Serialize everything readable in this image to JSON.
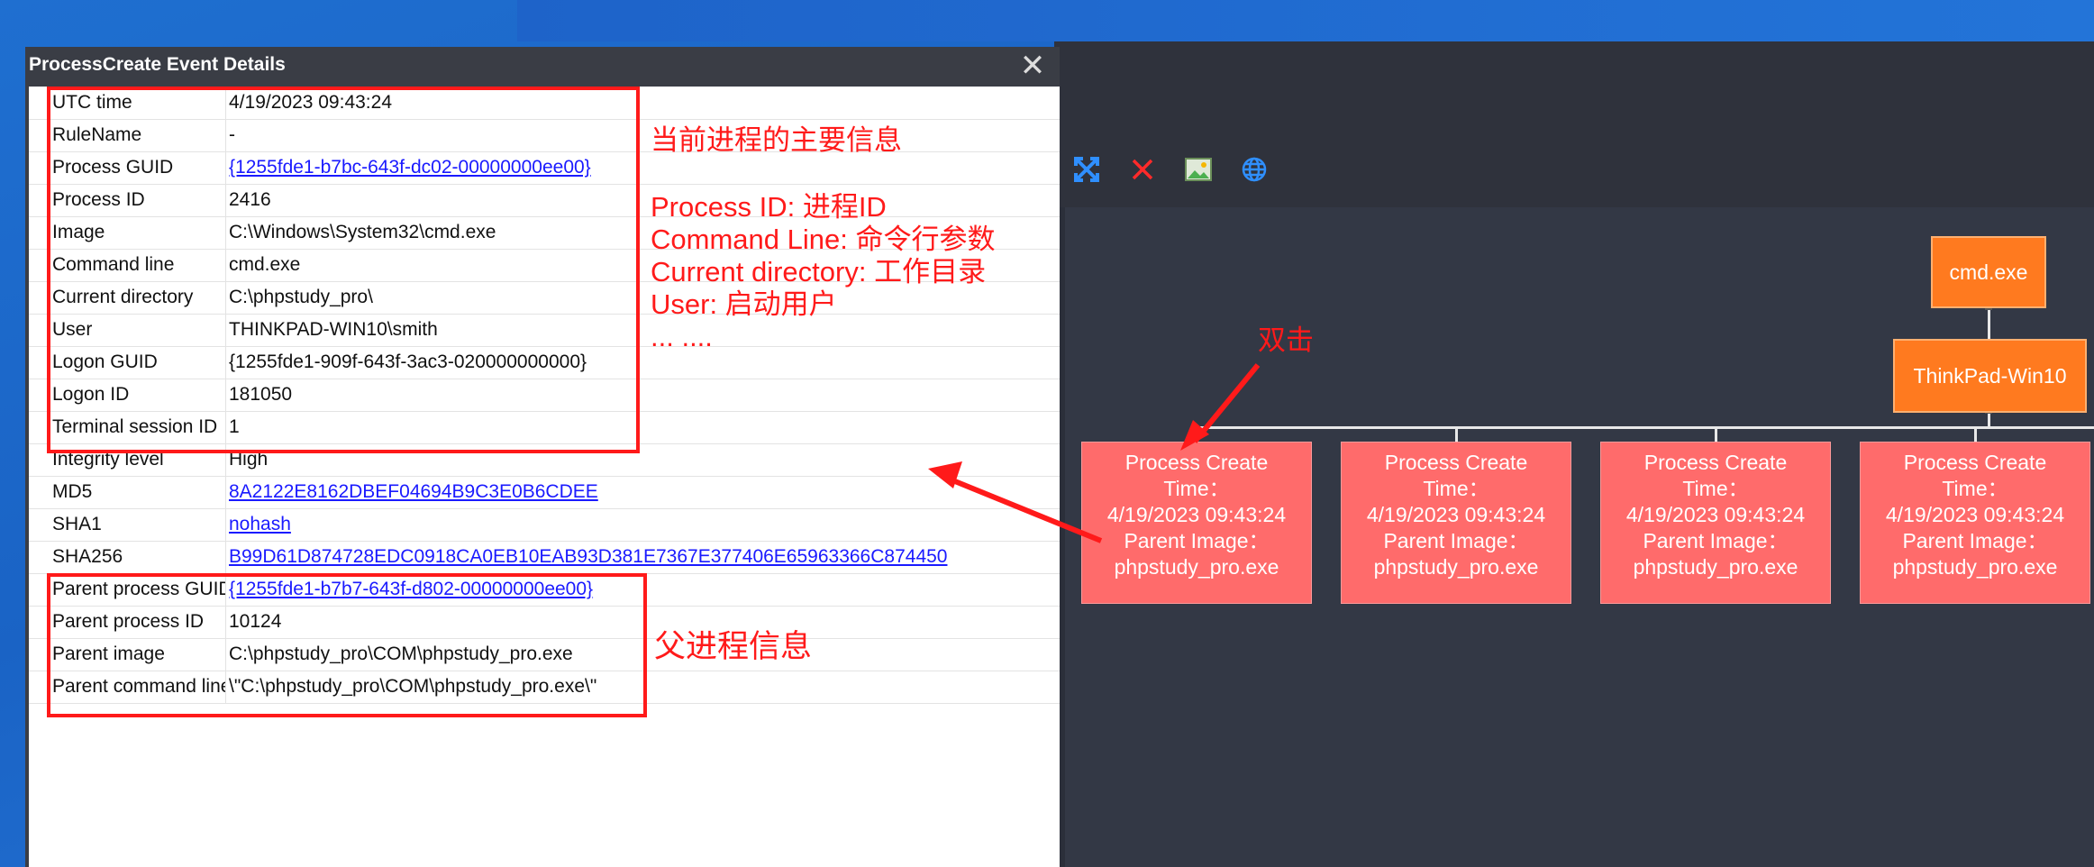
{
  "dialog": {
    "title": "ProcessCreate Event Details",
    "close_label": "✕",
    "rows": [
      {
        "key": "UTC time",
        "value": "4/19/2023 09:43:24",
        "link": false
      },
      {
        "key": "RuleName",
        "value": "-",
        "link": false
      },
      {
        "key": "Process GUID",
        "value": "{1255fde1-b7bc-643f-dc02-00000000ee00}",
        "link": true
      },
      {
        "key": "Process ID",
        "value": "2416",
        "link": false
      },
      {
        "key": "Image",
        "value": "C:\\Windows\\System32\\cmd.exe",
        "link": false
      },
      {
        "key": "Command line",
        "value": "cmd.exe",
        "link": false
      },
      {
        "key": "Current directory",
        "value": "C:\\phpstudy_pro\\",
        "link": false
      },
      {
        "key": "User",
        "value": "THINKPAD-WIN10\\smith",
        "link": false
      },
      {
        "key": "Logon GUID",
        "value": "{1255fde1-909f-643f-3ac3-020000000000}",
        "link": false
      },
      {
        "key": "Logon ID",
        "value": "181050",
        "link": false
      },
      {
        "key": "Terminal session ID",
        "value": "1",
        "link": false
      },
      {
        "key": "Integrity level",
        "value": "High",
        "link": false
      },
      {
        "key": "MD5",
        "value": "8A2122E8162DBEF04694B9C3E0B6CDEE",
        "link": true
      },
      {
        "key": "SHA1",
        "value": "nohash",
        "link": true
      },
      {
        "key": "SHA256",
        "value": "B99D61D874728EDC0918CA0EB10EAB93D381E7367E377406E65963366C874450",
        "link": true
      },
      {
        "key": "Parent process GUID",
        "value": "{1255fde1-b7b7-643f-d802-00000000ee00}",
        "link": true
      },
      {
        "key": "Parent process ID",
        "value": "10124",
        "link": false
      },
      {
        "key": "Parent image",
        "value": "C:\\phpstudy_pro\\COM\\phpstudy_pro.exe",
        "link": false
      },
      {
        "key": "Parent command line",
        "value": "\\\"C:\\phpstudy_pro\\COM\\phpstudy_pro.exe\\\"",
        "link": false
      }
    ]
  },
  "annotations": {
    "main_info": "当前进程的主要信息",
    "lines": [
      "Process ID: 进程ID",
      "Command Line: 命令行参数",
      "Current directory: 工作目录",
      "User: 启动用户",
      "... ...."
    ],
    "parent_info": "父进程信息",
    "double_click": "双击"
  },
  "toolbar": {
    "icons": [
      "fullscreen-icon",
      "delete-icon",
      "image-icon",
      "globe-icon"
    ]
  },
  "graph": {
    "root": "cmd.exe",
    "host": "ThinkPad-Win10",
    "nodes": [
      {
        "l1": "Process Create",
        "l2": "Time：",
        "l3": "4/19/2023 09:43:24",
        "l4": "Parent Image：",
        "l5": "phpstudy_pro.exe"
      },
      {
        "l1": "Process Create",
        "l2": "Time：",
        "l3": "4/19/2023 09:43:24",
        "l4": "Parent Image：",
        "l5": "phpstudy_pro.exe"
      },
      {
        "l1": "Process Create",
        "l2": "Time：",
        "l3": "4/19/2023 09:43:24",
        "l4": "Parent Image：",
        "l5": "phpstudy_pro.exe"
      },
      {
        "l1": "Process Create",
        "l2": "Time：",
        "l3": "4/19/2023 09:43:24",
        "l4": "Parent Image：",
        "l5": "phpstudy_pro.exe"
      }
    ]
  },
  "colors": {
    "annotation": "#ff1a1a",
    "node_orange": "#ff7a1f",
    "node_red": "#ff6b6b"
  }
}
